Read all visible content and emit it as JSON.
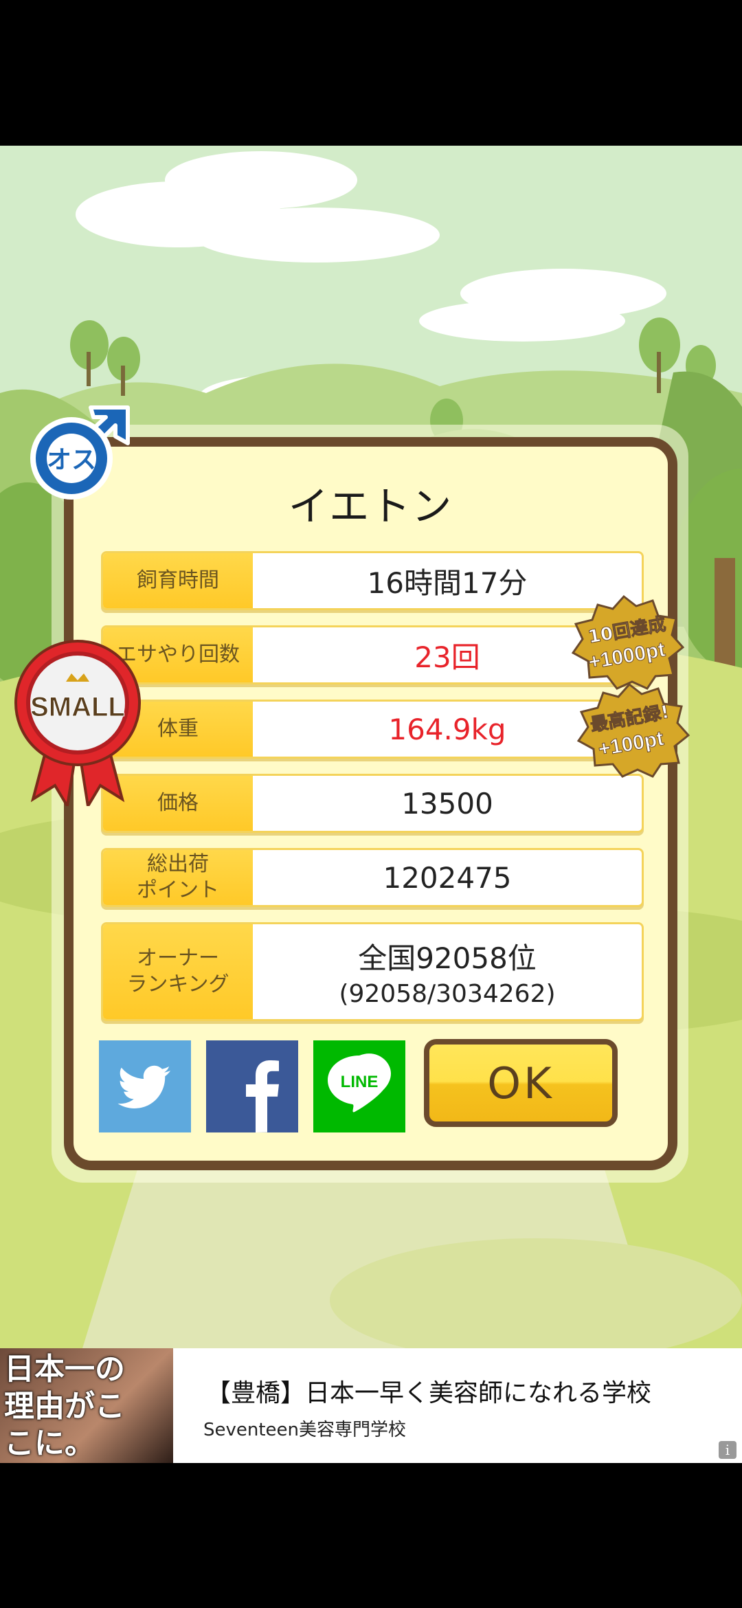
{
  "character": {
    "name": "イエトン",
    "gender_label": "オス",
    "size_badge": "SMALL"
  },
  "stats": [
    {
      "label": "飼育時間",
      "value": "16時間17分",
      "sub": "",
      "highlight": false
    },
    {
      "label": "エサやり回数",
      "value": "23回",
      "sub": "",
      "highlight": true
    },
    {
      "label": "体重",
      "value": "164.9kg",
      "sub": "",
      "highlight": true
    },
    {
      "label": "価格",
      "value": "13500",
      "sub": "",
      "highlight": false
    },
    {
      "label": "総出荷\nポイント",
      "value": "1202475",
      "sub": "",
      "highlight": false
    },
    {
      "label": "オーナー\nランキング",
      "value": "全国92058位",
      "sub": "(92058/3034262)",
      "highlight": false
    }
  ],
  "bonus_badges": [
    {
      "line1": "10回達成",
      "line2": "+1000pt"
    },
    {
      "line1": "最高記録!",
      "line2": "+100pt"
    }
  ],
  "share": {
    "twitter_color": "#5ea9dd",
    "facebook_color": "#3b5998",
    "line_color": "#00b900",
    "line_label": "LINE"
  },
  "ok_label": "OK",
  "ad": {
    "image_text": "日本一の理由がここに。",
    "headline": "【豊橋】日本一早く美容師になれる学校",
    "source": "Seventeen美容専門学校",
    "info": "i"
  },
  "colors": {
    "sky": "#cfe8c6",
    "frame": "#6b4a2c",
    "label_bg": "#ffcf36",
    "highlight_text": "#e8232a"
  }
}
